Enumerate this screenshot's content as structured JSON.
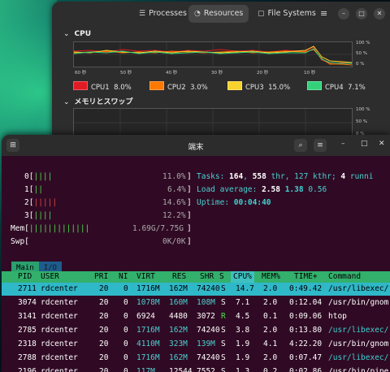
{
  "sysmon": {
    "tabs": [
      {
        "label": "Processes",
        "icon": "processes-icon"
      },
      {
        "label": "Resources",
        "icon": "resources-icon"
      },
      {
        "label": "File Systems",
        "icon": "filesystems-icon"
      }
    ],
    "active_tab": "Resources",
    "cpu_section": {
      "title": "CPU",
      "pct_labels": [
        "100 %",
        "50 %",
        "0 %"
      ],
      "time_labels": [
        "60 秒",
        "50 秒",
        "40 秒",
        "30 秒",
        "20 秒",
        "10 秒"
      ],
      "legend": [
        {
          "name": "CPU1",
          "value": "8.0%",
          "color": "#e01b24"
        },
        {
          "name": "CPU2",
          "value": "3.0%",
          "color": "#ff7800"
        },
        {
          "name": "CPU3",
          "value": "15.0%",
          "color": "#f6d32d"
        },
        {
          "name": "CPU4",
          "value": "7.1%",
          "color": "#33d17a"
        }
      ]
    },
    "mem_section": {
      "title": "メモリとスワップ",
      "pct_labels": [
        "100 %",
        "50 %",
        "0 %"
      ]
    }
  },
  "terminal": {
    "title": "端末",
    "meters": [
      {
        "label": "0",
        "bar": "||||",
        "value": "11.0%"
      },
      {
        "label": "1",
        "bar": "||",
        "value": "6.4%"
      },
      {
        "label": "2",
        "bar": "|||||",
        "value": "14.6%"
      },
      {
        "label": "3",
        "bar": "||||",
        "value": "12.2%"
      },
      {
        "label": "Mem",
        "bar": "|||||||||||||",
        "value": "1.69G/7.75G"
      },
      {
        "label": "Swp",
        "bar": "",
        "value": "0K/0K"
      }
    ],
    "tasks": {
      "prefix": "Tasks: ",
      "count": "164",
      "sep1": ", ",
      "thr": "558",
      "thr_label": " thr, ",
      "kthr": "127 kthr",
      "sep2": "; ",
      "running": "4",
      "running_label": " runni"
    },
    "load": {
      "prefix": "Load average: ",
      "l1": "2.58",
      "l5": "1.38",
      "l15": "0.56"
    },
    "uptime": {
      "prefix": "Uptime: ",
      "value": "00:04:40"
    },
    "htop_tabs": [
      "Main",
      "I/O"
    ],
    "columns": [
      "PID",
      "USER",
      "PRI",
      "NI",
      "VIRT",
      "RES",
      "SHR",
      "S",
      "CPU%",
      "MEM%",
      "TIME+",
      "Command"
    ],
    "processes": [
      {
        "pid": "2711",
        "user": "rdcenter",
        "pri": "20",
        "ni": "0",
        "virt": "1716M",
        "res": "162M",
        "shr": "74240",
        "s": "S",
        "cpu": "14.7",
        "mem": "2.0",
        "time": "0:49.42",
        "cmd": "/usr/libexec/",
        "selected": true
      },
      {
        "pid": "3074",
        "user": "rdcenter",
        "pri": "20",
        "ni": "0",
        "virt": "1078M",
        "res": "160M",
        "shr": "108M",
        "s": "S",
        "cpu": "7.1",
        "mem": "2.0",
        "time": "0:12.04",
        "cmd": "/usr/bin/gnom"
      },
      {
        "pid": "3141",
        "user": "rdcenter",
        "pri": "20",
        "ni": "0",
        "virt": "6924",
        "res": "4480",
        "shr": "3072",
        "s": "R",
        "cpu": "4.5",
        "mem": "0.1",
        "time": "0:09.06",
        "cmd": "htop"
      },
      {
        "pid": "2785",
        "user": "rdcenter",
        "pri": "20",
        "ni": "0",
        "virt": "1716M",
        "res": "162M",
        "shr": "74240",
        "s": "S",
        "cpu": "3.8",
        "mem": "2.0",
        "time": "0:13.80",
        "cmd": "/usr/libexec/"
      },
      {
        "pid": "2318",
        "user": "rdcenter",
        "pri": "20",
        "ni": "0",
        "virt": "4110M",
        "res": "323M",
        "shr": "139M",
        "s": "S",
        "cpu": "1.9",
        "mem": "4.1",
        "time": "4:22.20",
        "cmd": "/usr/bin/gnom"
      },
      {
        "pid": "2788",
        "user": "rdcenter",
        "pri": "20",
        "ni": "0",
        "virt": "1716M",
        "res": "162M",
        "shr": "74240",
        "s": "S",
        "cpu": "1.9",
        "mem": "2.0",
        "time": "0:07.47",
        "cmd": "/usr/libexec/"
      },
      {
        "pid": "2196",
        "user": "rdcenter",
        "pri": "20",
        "ni": "0",
        "virt": "117M",
        "res": "12544",
        "shr": "7552",
        "s": "S",
        "cpu": "1.3",
        "mem": "0.2",
        "time": "0:02.86",
        "cmd": "/usr/bin/pipe"
      }
    ]
  }
}
